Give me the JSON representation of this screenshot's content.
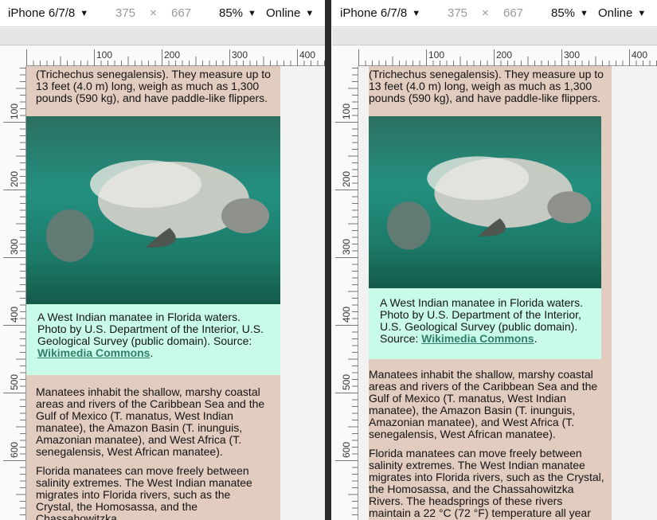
{
  "toolbar": {
    "device": "iPhone 6/7/8",
    "width": "375",
    "times": "×",
    "height": "667",
    "zoom": "85%",
    "network": "Online"
  },
  "ruler": {
    "h_ticks": [
      "100",
      "200",
      "300",
      "400"
    ],
    "v_ticks": [
      "100",
      "200",
      "300",
      "400",
      "500",
      "600"
    ]
  },
  "left": {
    "intro": "(Trichechus senegalensis). They measure up to 13 feet (4.0 m) long, weigh as much as 1,300 pounds (590 kg), and have paddle-like flippers.",
    "caption_text": "A West Indian manatee in Florida waters. Photo by U.S. Department of the Interior, U.S. Geological Survey (public domain). Source:",
    "caption_link": "Wikimedia Commons",
    "caption_end": ".",
    "para1": "Manatees inhabit the shallow, marshy coastal areas and rivers of the Caribbean Sea and the Gulf of Mexico (T. manatus, West Indian manatee), the Amazon Basin (T. inunguis, Amazonian manatee), and West Africa (T. senegalensis, West African manatee).",
    "para2": "Florida manatees can move freely between salinity extremes. The West Indian manatee migrates into Florida rivers, such as the Crystal, the Homosassa, and the Chassahowitzka"
  },
  "right": {
    "intro": "(Trichechus senegalensis). They measure up to 13 feet (4.0 m) long, weigh as much as 1,300 pounds (590 kg), and have paddle-like flippers.",
    "caption_text": "A West Indian manatee in Florida waters. Photo by U.S. Department of the Interior, U.S. Geological Survey (public domain). Source:",
    "caption_link": "Wikimedia Commons",
    "caption_end": ".",
    "para1": "Manatees inhabit the shallow, marshy coastal areas and rivers of the Caribbean Sea and the Gulf of Mexico (T. manatus, West Indian manatee), the Amazon Basin (T. inunguis, Amazonian manatee), and West Africa (T. senegalensis, West African manatee).",
    "para2": "Florida manatees can move freely between salinity extremes. The West Indian manatee migrates into Florida rivers, such as the Crystal, the Homosassa, and the Chassahowitzka Rivers. The headsprings of these rivers maintain a 22 °C (72 °F) temperature all year"
  },
  "colors": {
    "page_bg": "#e2cbbf",
    "figure_bg": "#c9fbe9",
    "link": "#2f7f6b"
  }
}
